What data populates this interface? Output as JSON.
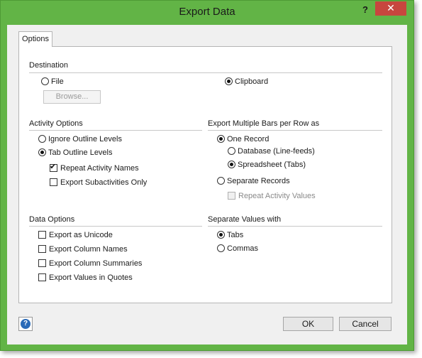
{
  "window": {
    "title": "Export Data",
    "help_glyph": "?",
    "close_glyph": "✕"
  },
  "tab": {
    "label": "Options"
  },
  "destination": {
    "label": "Destination",
    "file_label": "File",
    "clipboard_label": "Clipboard",
    "browse_label": "Browse...",
    "selected": "clipboard"
  },
  "activity": {
    "label": "Activity Options",
    "ignore_label": "Ignore Outline Levels",
    "tab_label": "Tab Outline Levels",
    "repeat_names_label": "Repeat Activity Names",
    "export_sub_label": "Export Subactivities Only"
  },
  "multibar": {
    "label": "Export Multiple Bars per Row as",
    "one_record_label": "One Record",
    "database_label": "Database (Line-feeds)",
    "spreadsheet_label": "Spreadsheet (Tabs)",
    "separate_label": "Separate Records",
    "repeat_values_label": "Repeat Activity Values"
  },
  "data_options": {
    "label": "Data Options",
    "unicode_label": "Export as Unicode",
    "column_names_label": "Export Column Names",
    "column_summaries_label": "Export Column Summaries",
    "quotes_label": "Export Values in Quotes"
  },
  "separator": {
    "label": "Separate Values with",
    "tabs_label": "Tabs",
    "commas_label": "Commas"
  },
  "footer": {
    "help_glyph": "?",
    "ok_label": "OK",
    "cancel_label": "Cancel"
  },
  "colors": {
    "frame": "#62b446",
    "close": "#c7463e",
    "help": "#2a6ab8"
  }
}
